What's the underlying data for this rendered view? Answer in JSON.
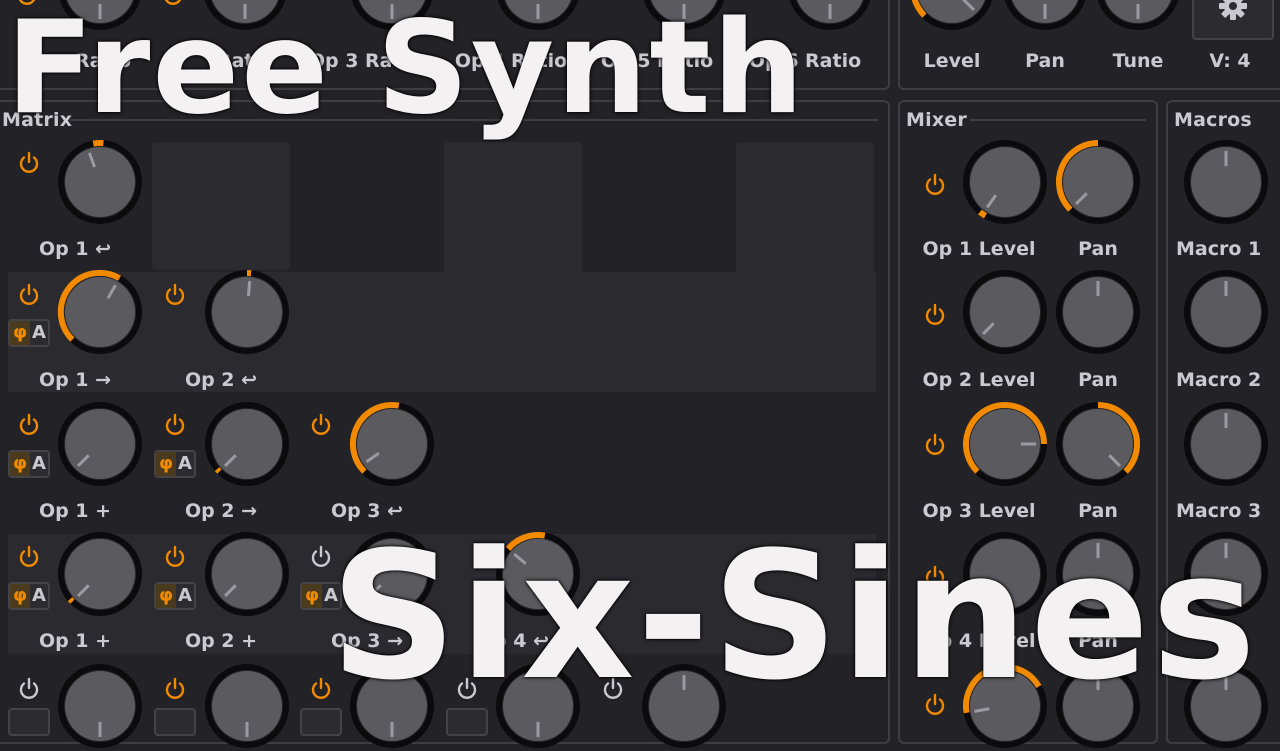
{
  "top_bar": {
    "ratio_labels": [
      "Ratio",
      "Ratio",
      "Op 3 Ratio",
      "Op 4 Ratio",
      "Op 5 Ratio",
      "Op 6 Ratio"
    ],
    "main_labels": [
      "Level",
      "Pan",
      "Tune"
    ],
    "voices": "V: 4"
  },
  "matrix": {
    "title": "Matrix",
    "rows": [
      [
        "Op 1 ↩"
      ],
      [
        "Op 1 →",
        "Op 2 ↩"
      ],
      [
        "Op 1 +",
        "Op 2 →",
        "Op 3 ↩"
      ],
      [
        "Op 1 +",
        "Op 2 +",
        "Op 3 →",
        "Op 4 ↩"
      ]
    ],
    "phase_badge": {
      "symbol": "φ",
      "letter": "A"
    }
  },
  "mixer": {
    "title": "Mixer",
    "rows": [
      {
        "level": "Op 1 Level",
        "pan": "Pan"
      },
      {
        "level": "Op 2 Level",
        "pan": "Pan"
      },
      {
        "level": "Op 3 Level",
        "pan": "Pan"
      },
      {
        "level": "Op 4 Level",
        "pan": "Pan"
      }
    ]
  },
  "macros": {
    "title": "Macros",
    "items": [
      "Macro 1",
      "Macro 2",
      "Macro 3"
    ]
  },
  "overlay": {
    "title_top": "Free Synth",
    "title_bottom": "Six-Sines"
  },
  "colors": {
    "accent": "#f28a00",
    "background": "#232327",
    "knob": "#5a5a5f",
    "ring": "#0b0b0d",
    "text": "#c9c9cf"
  },
  "icons": [
    "power-icon",
    "gear-icon",
    "phase-icon"
  ]
}
